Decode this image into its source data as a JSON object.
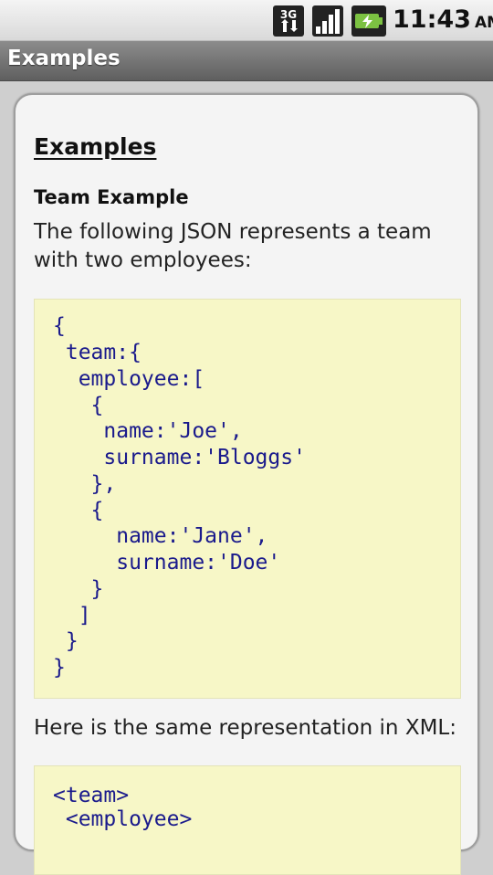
{
  "status_bar": {
    "time": "11:43",
    "ampm": "AM",
    "network_badge": "3G",
    "icons": [
      "3g-data-icon",
      "signal-strength-icon",
      "battery-charging-icon"
    ]
  },
  "title_bar": {
    "title": "Examples"
  },
  "content": {
    "section_title": "Examples",
    "subsection_title": "Team Example",
    "intro_text": "The following JSON represents a team with two employees:",
    "json_code": [
      "{",
      " team:{",
      "  employee:[",
      "   {",
      "    name:'Joe',",
      "    surname:'Bloggs'",
      "   },",
      "   {",
      "     name:'Jane',",
      "     surname:'Doe'",
      "   }",
      "  ]",
      " }",
      "}"
    ],
    "xml_intro_text": "Here is the same representation in XML:",
    "xml_code": [
      "<team>",
      " <employee>"
    ]
  },
  "colors": {
    "code_background": "#f7f7c7",
    "code_text": "#1a1a8c",
    "title_bar": "#6f6f6f"
  }
}
